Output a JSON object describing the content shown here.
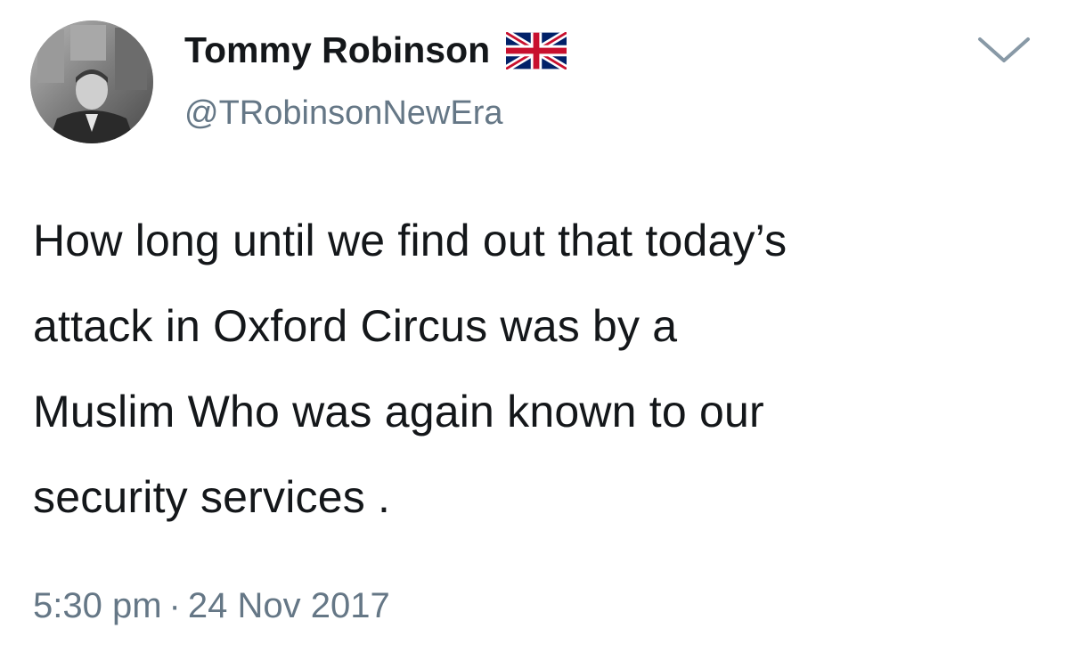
{
  "tweet": {
    "author": {
      "display_name": "Tommy Robinson",
      "handle": "@TRobinsonNewEra",
      "badge_icon": "union-jack-flag-icon"
    },
    "menu_icon": "chevron-down-icon",
    "text_lines": [
      "How long until we find out that today’s",
      "attack in Oxford Circus was by a",
      "Muslim Who was again known to our",
      "security services ."
    ],
    "time": "5:30 pm",
    "separator": "·",
    "date": "24 Nov 2017"
  },
  "colors": {
    "text_primary": "#14171a",
    "text_secondary": "#657786",
    "flag_blue": "#012169",
    "flag_red": "#C8102E"
  }
}
